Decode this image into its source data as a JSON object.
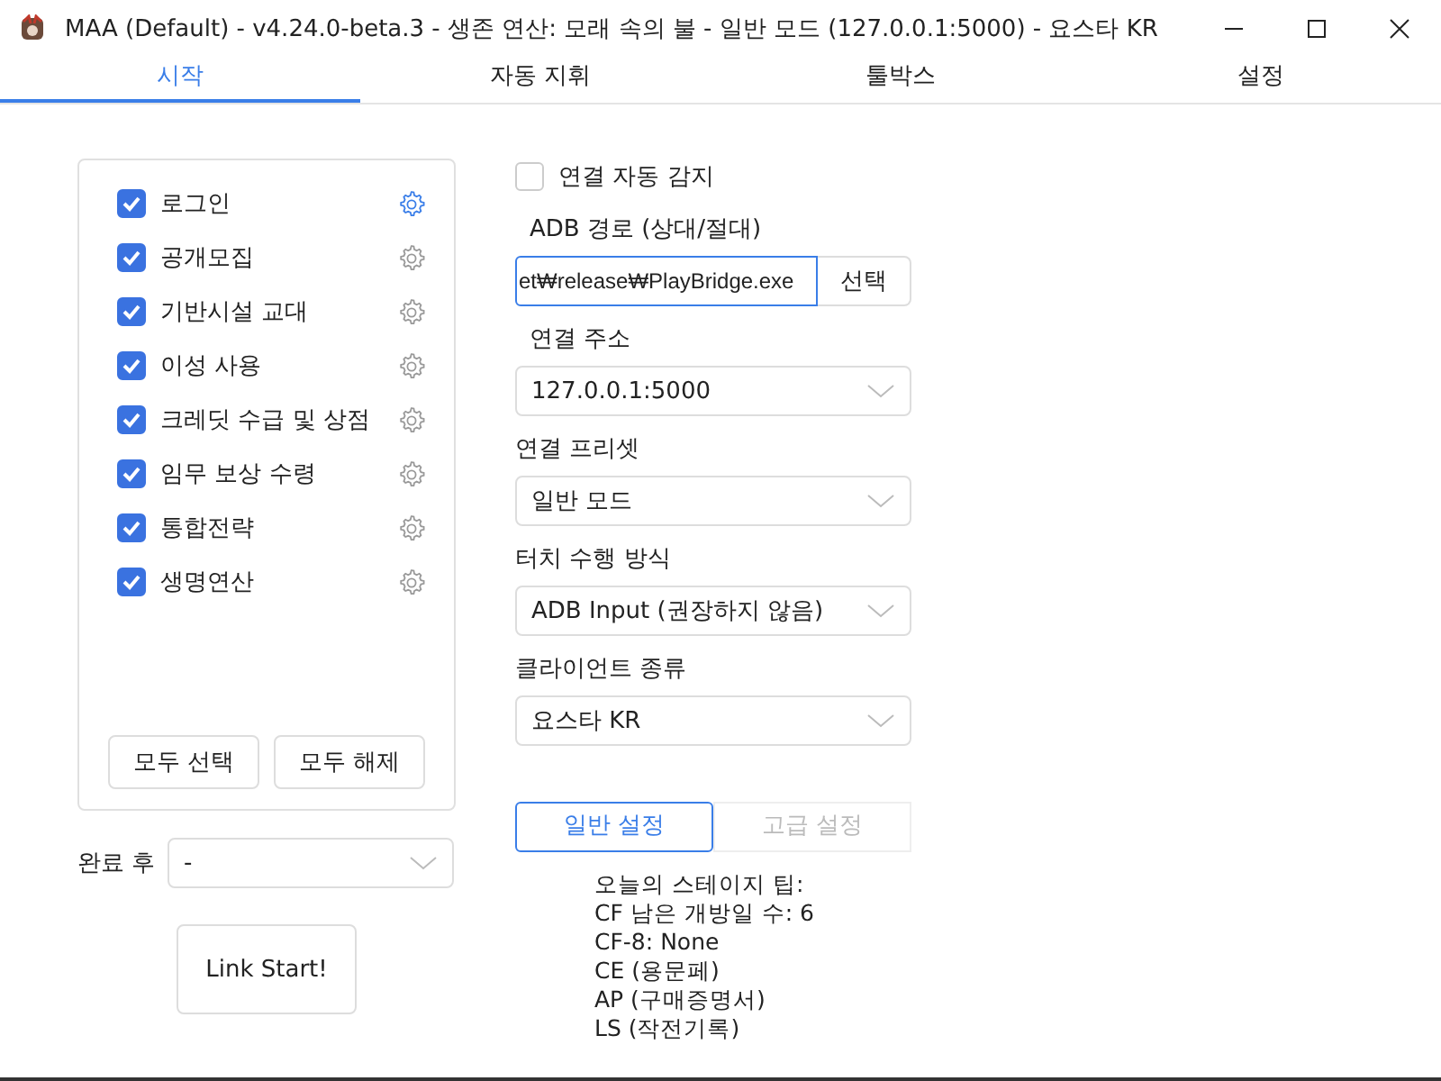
{
  "window": {
    "title": "MAA (Default) - v4.24.0-beta.3 - 생존 연산: 모래 속의 불 - 일반 모드 (127.0.0.1:5000) - 요스타 KR"
  },
  "tabs": [
    {
      "label": "시작",
      "selected": true
    },
    {
      "label": "자동 지휘",
      "selected": false
    },
    {
      "label": "툴박스",
      "selected": false
    },
    {
      "label": "설정",
      "selected": false
    }
  ],
  "tasks": [
    {
      "label": "로그인",
      "checked": true,
      "selected": true
    },
    {
      "label": "공개모집",
      "checked": true,
      "selected": false
    },
    {
      "label": "기반시설 교대",
      "checked": true,
      "selected": false
    },
    {
      "label": "이성 사용",
      "checked": true,
      "selected": false
    },
    {
      "label": "크레딧 수급 및 상점",
      "checked": true,
      "selected": false
    },
    {
      "label": "임무 보상 수령",
      "checked": true,
      "selected": false
    },
    {
      "label": "통합전략",
      "checked": true,
      "selected": false
    },
    {
      "label": "생명연산",
      "checked": true,
      "selected": false
    }
  ],
  "task_buttons": [
    "모두 선택",
    "모두 해제"
  ],
  "after_completion": {
    "label": "완료 후",
    "value": "-"
  },
  "start_button": "Link Start!",
  "auto_detect": {
    "label": "연결 자동 감지",
    "checked": false
  },
  "adb_path": {
    "label": "ADB 경로 (상대/절대)",
    "value": "et₩release₩PlayBridge.exe",
    "button": "선택"
  },
  "dropdowns": [
    {
      "label": "연결 주소",
      "value": "127.0.0.1:5000"
    },
    {
      "label": "연결 프리셋",
      "value": "일반 모드"
    },
    {
      "label": "터치 수행 방식",
      "value": "ADB Input (권장하지 않음)"
    },
    {
      "label": "클라이언트 종류",
      "value": "요스타 KR"
    }
  ],
  "settings_tabs": [
    {
      "label": "일반 설정",
      "selected": true
    },
    {
      "label": "고급 설정",
      "selected": false
    }
  ],
  "stage_tips": [
    "오늘의 스테이지 팁:",
    "CF 남은 개방일 수: 6",
    "CF-8: None",
    "CE (용문페)",
    "AP (구매증명서)",
    "LS (작전기록)"
  ]
}
